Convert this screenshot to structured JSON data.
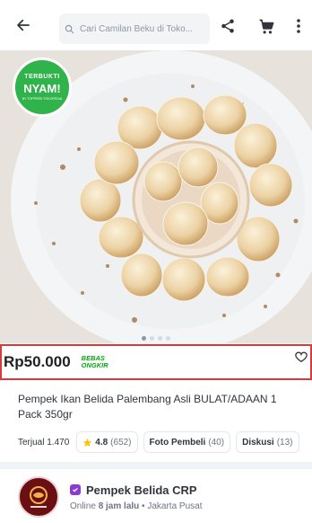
{
  "header": {
    "search_placeholder": "Cari Camilan Beku di Toko...",
    "icons": [
      "back-arrow-icon",
      "search-icon",
      "share-icon",
      "cart-icon",
      "more-vertical-icon"
    ]
  },
  "gallery": {
    "badge_top": "TERBUKTI",
    "badge_main": "NYAM!",
    "badge_bottom": "BY TOPPERS TOKOPEDIA",
    "badge_color": "#2fb34a"
  },
  "product": {
    "price": "Rp50.000",
    "free_shipping_line1": "BEBAS",
    "free_shipping_line2": "ONGKIR",
    "title": "Pempek Ikan Belida Palembang Asli BULAT/ADAAN 1 Pack 350gr",
    "sold": "Terjual 1.470",
    "rating": "4.8",
    "rating_count": "(652)",
    "buyer_photos_label": "Foto Pembeli",
    "buyer_photos_count": "(40)",
    "discussion_label": "Diskusi",
    "discussion_count": "(13)"
  },
  "shop": {
    "name": "Pempek Belida CRP",
    "status_online": "Online",
    "status_time": "8 jam lalu",
    "location": "Jakarta Pusat",
    "badge_color": "#8c3bd1",
    "accent": "#d93a3a"
  }
}
